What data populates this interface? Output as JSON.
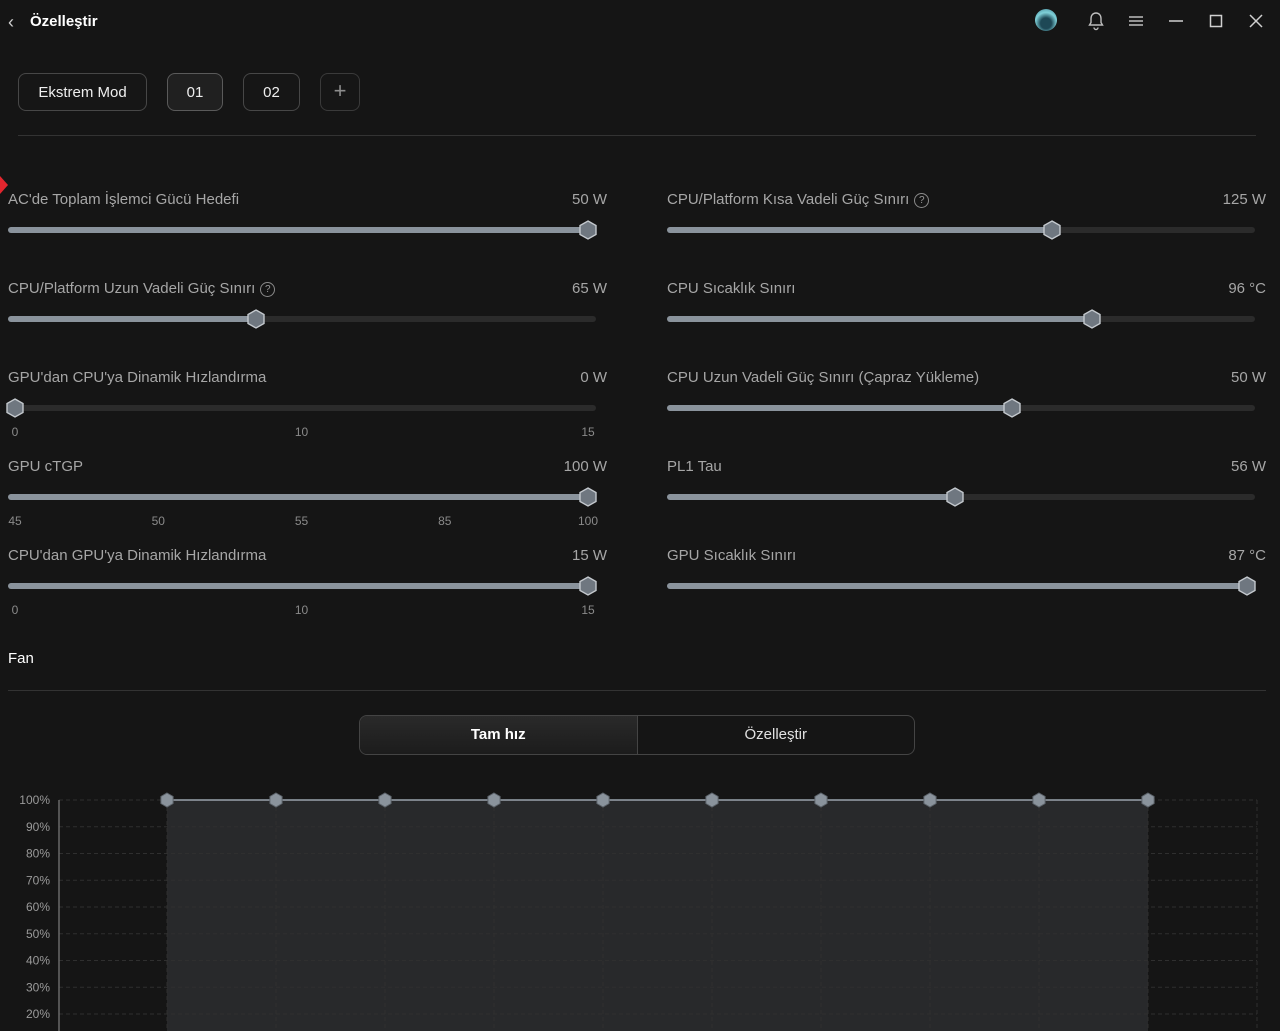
{
  "header": {
    "back_icon": "chevron-left-icon",
    "title": "Özelleştir"
  },
  "modes": {
    "items": [
      "Ekstrem Mod",
      "01",
      "02"
    ],
    "active": "01",
    "add_icon": "plus-icon"
  },
  "sliders": [
    {
      "label": "AC'de Toplam İşlemci Gücü Hedefi",
      "value": "50 W",
      "fraction": 1.0,
      "help": false,
      "ticks": []
    },
    {
      "label": "CPU/Platform Kısa Vadeli Güç Sınırı",
      "value": "125 W",
      "fraction": 0.66,
      "help": true,
      "ticks": []
    },
    {
      "label": "CPU/Platform Uzun Vadeli Güç Sınırı",
      "value": "65 W",
      "fraction": 0.42,
      "help": true,
      "ticks": []
    },
    {
      "label": "CPU Sıcaklık Sınırı",
      "value": "96 °C",
      "fraction": 0.73,
      "help": false,
      "ticks": []
    },
    {
      "label": "GPU'dan CPU'ya Dinamik Hızlandırma",
      "value": "0 W",
      "fraction": 0.0,
      "help": false,
      "ticks": [
        "0",
        "10",
        "15"
      ]
    },
    {
      "label": "CPU Uzun Vadeli Güç Sınırı (Çapraz Yükleme)",
      "value": "50 W",
      "fraction": 0.59,
      "help": false,
      "ticks": []
    },
    {
      "label": "GPU cTGP",
      "value": "100 W",
      "fraction": 1.0,
      "help": false,
      "ticks": [
        "45",
        "50",
        "55",
        "85",
        "100"
      ]
    },
    {
      "label": "PL1 Tau",
      "value": "56 W",
      "fraction": 0.49,
      "help": false,
      "ticks": []
    },
    {
      "label": "CPU'dan GPU'ya Dinamik Hızlandırma",
      "value": "15 W",
      "fraction": 1.0,
      "help": false,
      "ticks": [
        "0",
        "10",
        "15"
      ]
    },
    {
      "label": "GPU Sıcaklık Sınırı",
      "value": "87 °C",
      "fraction": 1.0,
      "help": false,
      "ticks": []
    }
  ],
  "fan": {
    "title": "Fan",
    "modes": [
      "Tam hız",
      "Özelleştir"
    ],
    "active_mode": "Tam hız"
  },
  "chart_data": {
    "type": "area",
    "ytick_labels": [
      "100%",
      "90%",
      "80%",
      "70%",
      "60%",
      "50%",
      "40%",
      "30%",
      "20%"
    ],
    "ylim": [
      0,
      100
    ],
    "grid": true,
    "series": [
      {
        "values": [
          100,
          100,
          100,
          100,
          100,
          100,
          100,
          100,
          100,
          100
        ]
      }
    ],
    "colors": {
      "fill": "#2a2b2e",
      "line": "#9aa3ad",
      "point": "#8a939c"
    }
  },
  "colors": {
    "background": "#151515",
    "accent_red": "#e3262e",
    "slider_fill": "#8a939c"
  }
}
